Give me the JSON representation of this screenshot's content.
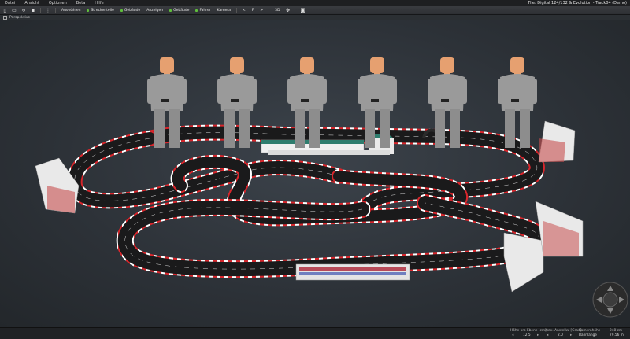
{
  "menu": [
    "Datei",
    "Ansicht",
    "Optionen",
    "Beta",
    "Hilfe"
  ],
  "window_title": "File: Digital 124/132 & Evolution - Track04 (Demo)",
  "toolbar": {
    "select_label": "Auswählen",
    "track_parts_label": "Streckenteile",
    "buildings_label": "Gebäude",
    "displays_label": "Anzeigen",
    "buildings2_label": "Gebäude",
    "drivers_label": "Fahrer",
    "camera_label": "Kamera",
    "zoom_out_label": "<",
    "zoom_label": "F",
    "zoom_in_label": ">",
    "view_label": "3D"
  },
  "view": {
    "mode_label": "Perspektive"
  },
  "status": {
    "height_label": "Höhe pro Ebene [cm]",
    "height_value": "12.5",
    "max_slope_label": "max. Anstellw. [Grad]",
    "max_slope_value": "2.0",
    "camera_height_label": "Kamerahöhe",
    "camera_height_value": "248 cm",
    "track_length_label": "Bahnlänge",
    "track_length_value": "79.56 m"
  },
  "colors": {
    "track": "#1a1a1b",
    "lane_line": "#d9d9d9",
    "curb_red": "#d8262c",
    "curb_white": "#ffffff",
    "figure_shirt": "#9a9a9a",
    "figure_skin": "#e6a070"
  },
  "drivers_count": 6
}
